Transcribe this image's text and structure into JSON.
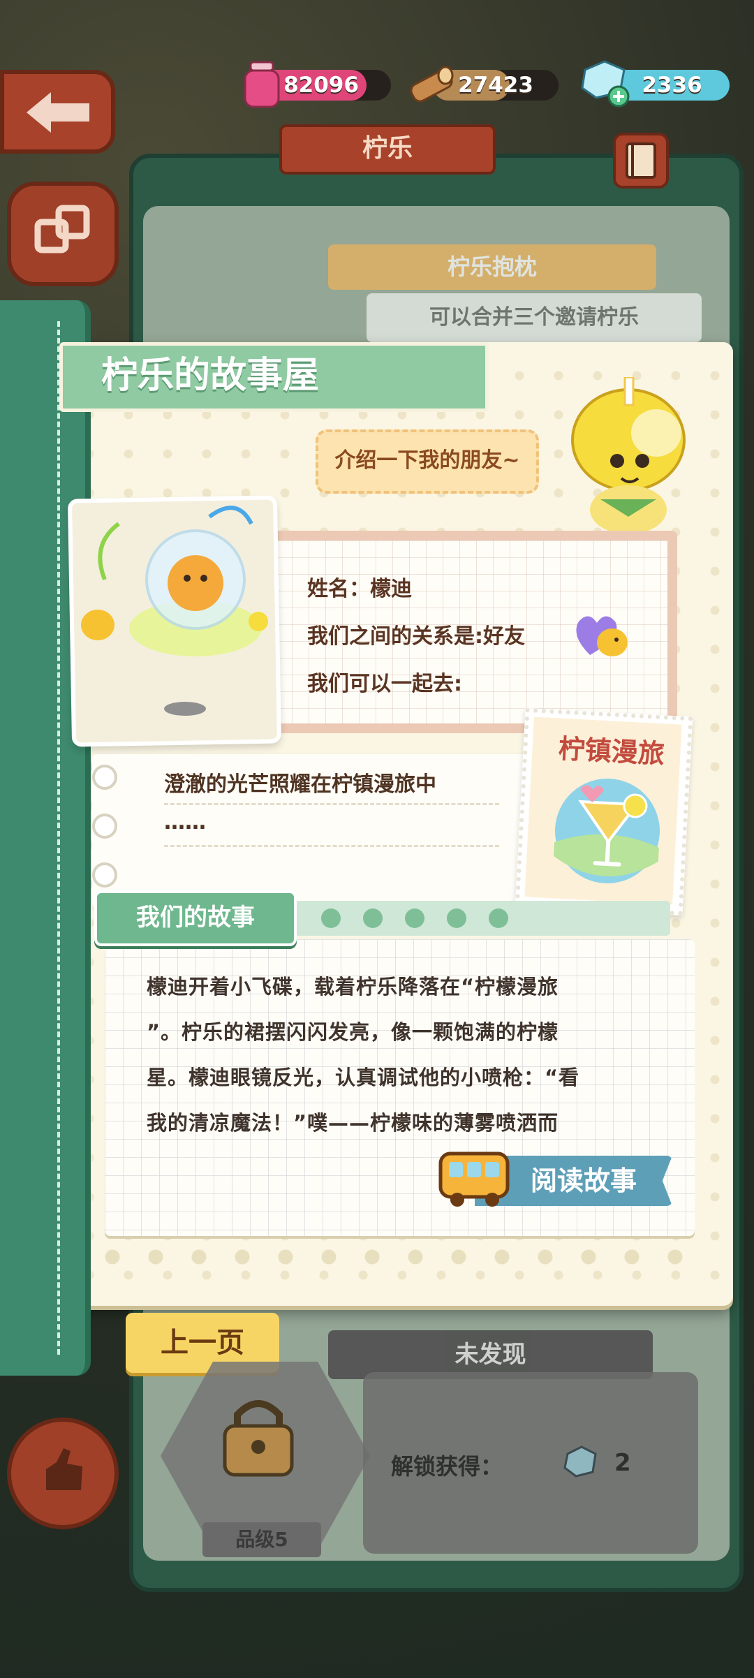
{
  "resources": {
    "jam": "82096",
    "wood": "27423",
    "gems": "2336"
  },
  "panel": {
    "title": "柠乐",
    "subtitle": "柠乐抱枕",
    "hint": "可以合并三个邀请柠乐"
  },
  "storybook": {
    "title": "柠乐的故事屋",
    "intro_bubble": "介绍一下我的朋友~",
    "info": {
      "name_line": "姓名：檬迪",
      "relation_line": "我们之间的关系是:好友",
      "go_line": "我们可以一起去:"
    },
    "description": {
      "line1": "澄澈的光芒照耀在柠镇漫旅中",
      "line2": "……"
    },
    "stamp_title": "柠镇漫旅",
    "story_tag": "我们的故事",
    "story_lines": [
      "檬迪开着小飞碟，载着柠乐降落在“柠檬漫旅",
      "”。柠乐的裙摆闪闪发亮，像一颗饱满的柠檬",
      "星。檬迪眼镜反光，认真调试他的小喷枪：“看",
      "我的清凉魔法！”噗——柠檬味的薄雾喷洒而"
    ],
    "read_button": "阅读故事",
    "prev_button": "上一页"
  },
  "lower_card": {
    "status": "未发现",
    "unlock_label": "解锁获得：",
    "unlock_count": "2",
    "grade": "品级5"
  },
  "colors": {
    "book_green": "#3e8a6e",
    "banner_green": "#8fcaa2",
    "accent_yellow": "#f7d564",
    "read_blue": "#5e9fb8",
    "stamp_red": "#c24b3e"
  },
  "icons": [
    "back-arrow-icon",
    "jam-jar-icon",
    "wood-log-icon",
    "gem-icon",
    "book-icon",
    "layers-icon",
    "lock-icon",
    "hand-icon",
    "bus-icon"
  ]
}
